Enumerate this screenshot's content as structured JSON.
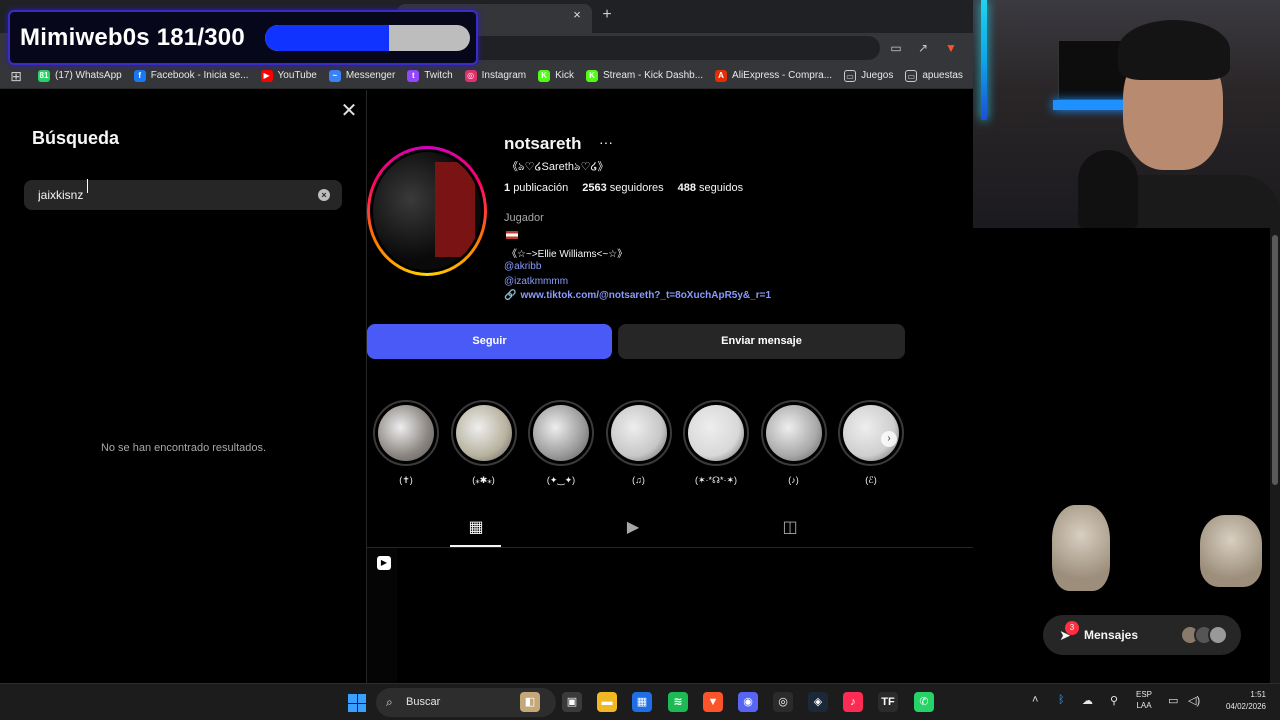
{
  "overlay": {
    "title": "Mimiweb0s 181/300",
    "progress_fraction": 0.6033
  },
  "browser": {
    "tab_close": "×",
    "new_tab": "+",
    "bookmarks": [
      {
        "label": "(17) WhatsApp",
        "icon": "whatsapp-icon",
        "color": "#25d366",
        "glyph": "81"
      },
      {
        "label": "Facebook - Inicia se...",
        "icon": "facebook-icon",
        "color": "#1877f2",
        "glyph": "f"
      },
      {
        "label": "YouTube",
        "icon": "youtube-icon",
        "color": "#ff0000",
        "glyph": "▶"
      },
      {
        "label": "Messenger",
        "icon": "messenger-icon",
        "color": "#3b82f6",
        "glyph": "~"
      },
      {
        "label": "Twitch",
        "icon": "twitch-icon",
        "color": "#9146ff",
        "glyph": "t"
      },
      {
        "label": "Instagram",
        "icon": "instagram-icon",
        "color": "#e1306c",
        "glyph": "◎"
      },
      {
        "label": "Kick",
        "icon": "kick-icon",
        "color": "#53fc18",
        "glyph": "K"
      },
      {
        "label": "Stream - Kick Dashb...",
        "icon": "kick-icon",
        "color": "#53fc18",
        "glyph": "K"
      },
      {
        "label": "AliExpress - Compra...",
        "icon": "aliexpress-icon",
        "color": "#e62e04",
        "glyph": "A"
      },
      {
        "label": "Juegos",
        "icon": "folder-icon",
        "color": "transparent",
        "glyph": "▭"
      },
      {
        "label": "apuestas",
        "icon": "folder-icon",
        "color": "transparent",
        "glyph": "▭"
      }
    ]
  },
  "search": {
    "title": "Búsqueda",
    "close_glyph": "✕",
    "query": "jaixkisnz",
    "clear_glyph": "×",
    "empty_message": "No se han encontrado resultados."
  },
  "profile": {
    "username": "notsareth",
    "more_glyph": "···",
    "fullname": "《ঌ♡໒Sarethঌ♡໒》",
    "posts_count": "1",
    "posts_label": "publicación",
    "followers_count": "2563",
    "followers_label": "seguidores",
    "following_count": "488",
    "following_label": "seguidos",
    "category": "Jugador",
    "bio_line": "《☆~>Ellie Williams<~☆》",
    "mentions": [
      "@akribb",
      "@izatkmmmm"
    ],
    "link": "www.tiktok.com/@notsareth?_t=8oXuchApR5y&_r=1",
    "follow_label": "Seguir",
    "message_label": "Enviar mensaje",
    "highlights": [
      {
        "label": "(✝)",
        "color": "#8a8580"
      },
      {
        "label": "(⁎✱⁎)",
        "color": "#b7b29e"
      },
      {
        "label": "(✦‿✦)",
        "color": "#9a9a9a"
      },
      {
        "label": "(♫)",
        "color": "#c7c7c7"
      },
      {
        "label": "(✶·*☊*·✶)",
        "color": "#d8d8d8"
      },
      {
        "label": "(♪)",
        "color": "#a9a9a9"
      },
      {
        "label": "(ℰ)",
        "color": "#cfcfcf"
      }
    ],
    "next_glyph": "›"
  },
  "messages": {
    "label": "Mensajes",
    "badge": "3"
  },
  "taskbar": {
    "search_label": "Buscar",
    "lang_line1": "ESP",
    "lang_line2": "LAA",
    "time": "1:51",
    "date": "04/02/2026",
    "apps": [
      {
        "icon": "desktop-icon",
        "color": "#c4a87a",
        "glyph": "◧"
      },
      {
        "icon": "task-view-icon",
        "color": "#3a3a3a",
        "glyph": "▣"
      },
      {
        "icon": "file-explorer-icon",
        "color": "#f2b824",
        "glyph": "▬"
      },
      {
        "icon": "store-icon",
        "color": "#1e6ee6",
        "glyph": "▦"
      },
      {
        "icon": "spotify-icon",
        "color": "#1db954",
        "glyph": "≋"
      },
      {
        "icon": "brave-icon",
        "color": "#fb542b",
        "glyph": "▼"
      },
      {
        "icon": "discord-icon",
        "color": "#5865f2",
        "glyph": "◉"
      },
      {
        "icon": "obs-icon",
        "color": "#2b2b2b",
        "glyph": "◎"
      },
      {
        "icon": "steam-icon",
        "color": "#1b2838",
        "glyph": "◈"
      },
      {
        "icon": "tiktok-icon",
        "color": "#fe2c55",
        "glyph": "♪"
      },
      {
        "icon": "tf-icon",
        "color": "#2b2b2b",
        "glyph": "TF"
      },
      {
        "icon": "whatsapp-icon",
        "color": "#25d366",
        "glyph": "✆"
      }
    ]
  }
}
